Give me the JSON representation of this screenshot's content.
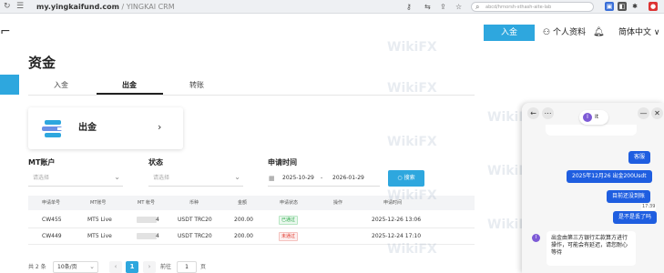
{
  "browser": {
    "domain": "my.yingkaifund.com",
    "path": " / YINGKAI CRM",
    "search_text": "abcd/hrnorsh-sthash-aite-lab"
  },
  "header": {
    "deposit_button": "入金",
    "profile_label": "个人资料",
    "language_label": "简体中文"
  },
  "page": {
    "title": "资金",
    "tabs": [
      {
        "label": "入金",
        "active": false
      },
      {
        "label": "出金",
        "active": true
      },
      {
        "label": "转账",
        "active": false
      }
    ],
    "card_title": "出金"
  },
  "filters": {
    "mt_account": {
      "label": "MT账户",
      "placeholder": "请选择"
    },
    "status": {
      "label": "状态",
      "placeholder": "请选择"
    },
    "date": {
      "label": "申请时间",
      "start": "2025-10-29",
      "separator": "-",
      "end": "2026-01-29"
    },
    "search_button": "搜索"
  },
  "table": {
    "headers": [
      "申请单号",
      "MT账号",
      "MT 帐号",
      "币种",
      "金额",
      "申请状态",
      "操作",
      "申请时间"
    ],
    "rows": [
      {
        "id": "CW455",
        "platform": "MT5 Live",
        "account_suffix": "4",
        "currency": "USDT TRC20",
        "amount": "200.00",
        "status": "已通过",
        "status_type": "ok",
        "time": "2025-12-26 13:06"
      },
      {
        "id": "CW449",
        "platform": "MT5 Live",
        "account_suffix": "4",
        "currency": "USDT TRC20",
        "amount": "200.00",
        "status": "未通过",
        "status_type": "no",
        "time": "2025-12-24 17:10"
      }
    ]
  },
  "pagination": {
    "total": "共 2 条",
    "page_size": "10条/页",
    "current_page": "1",
    "goto_label": "前往",
    "goto_value": "1",
    "page_unit": "页"
  },
  "watermark": "WikiFX",
  "chat": {
    "agent_initial": "I",
    "agent_name": "It",
    "messages_out": [
      "客服",
      "2025年12月26 出金200Usdt",
      "目前还没到账",
      "是不是丢了吗"
    ],
    "timestamp": "17:39",
    "message_in": "出金由第三方银行汇款算方进行操作，可能会有延迟，请您耐心等待"
  },
  "colors": {
    "accent": "#2ea7de",
    "chat_bubble": "#1f5ee0",
    "approved": "#27a744",
    "rejected": "#e0392b"
  }
}
